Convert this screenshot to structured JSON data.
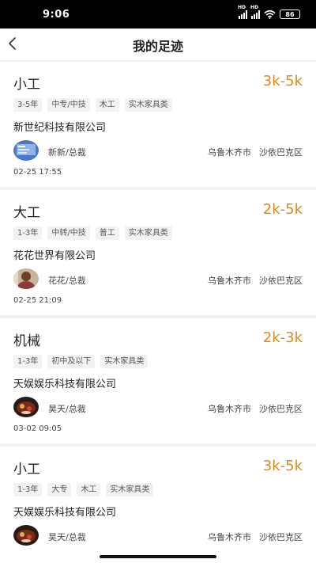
{
  "status": {
    "time": "9:06",
    "battery": "86",
    "sig1": "HD",
    "sig2": "HD"
  },
  "nav": {
    "title": "我的足迹"
  },
  "colors": {
    "salary": "#e08a1c"
  },
  "cards": [
    {
      "job": "小工",
      "salary": "3k-5k",
      "tags": [
        "3-5年",
        "中专/中技",
        "木工",
        "实木家具类"
      ],
      "company": "新世纪科技有限公司",
      "hr": "新新/总裁",
      "city": "乌鲁木齐市",
      "district": "沙依巴克区",
      "time": "02-25 17:55",
      "avatar_icon": "screen-avatar"
    },
    {
      "job": "大工",
      "salary": "2k-5k",
      "tags": [
        "1-3年",
        "中转/中技",
        "普工",
        "实木家具类"
      ],
      "company": "花花世界有限公司",
      "hr": "花花/总裁",
      "city": "乌鲁木齐市",
      "district": "沙依巴克区",
      "time": "02-25 21:09",
      "avatar_icon": "person-avatar"
    },
    {
      "job": "机械",
      "salary": "2k-3k",
      "tags": [
        "1-3年",
        "初中及以下",
        "实木家具类"
      ],
      "company": "天娱娱乐科技有限公司",
      "hr": "昊天/总裁",
      "city": "乌鲁木齐市",
      "district": "沙依巴克区",
      "time": "03-02 09:05",
      "avatar_icon": "food-avatar"
    },
    {
      "job": "小工",
      "salary": "3k-5k",
      "tags": [
        "1-3年",
        "大专",
        "木工",
        "实木家具类"
      ],
      "company": "天娱娱乐科技有限公司",
      "hr": "昊天/总裁",
      "city": "乌鲁木齐市",
      "district": "沙依巴克区",
      "time": "",
      "avatar_icon": "food-avatar"
    }
  ]
}
